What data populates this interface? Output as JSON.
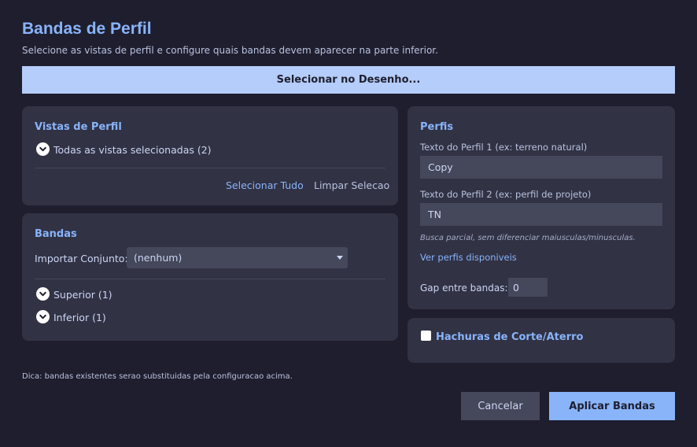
{
  "header": {
    "title": "Bandas de Perfil",
    "subtitle": "Selecione as vistas de perfil e configure quais bandas devem aparecer na parte inferior."
  },
  "select_button_label": "Selecionar no Desenho...",
  "vistas": {
    "title": "Vistas de Perfil",
    "all_selected_label": "Todas as vistas selecionadas (2)",
    "select_all_label": "Selecionar Tudo",
    "clear_label": "Limpar Selecao"
  },
  "bandas": {
    "title": "Bandas",
    "import_label": "Importar Conjunto:",
    "import_value": "(nenhum)",
    "superior_label": "Superior (1)",
    "inferior_label": "Inferior (1)"
  },
  "perfis": {
    "title": "Perfis",
    "profile1_label": "Texto do Perfil 1 (ex: terreno natural)",
    "profile1_value": "Copy",
    "profile2_label": "Texto do Perfil 2 (ex: perfil de projeto)",
    "profile2_value": "TN",
    "hint": "Busca parcial, sem diferenciar maiusculas/minusculas.",
    "view_profiles_link": "Ver perfis disponiveis",
    "gap_label": "Gap entre bandas:",
    "gap_value": "0"
  },
  "hachuras": {
    "label": "Hachuras de Corte/Aterro",
    "checked": false
  },
  "footer": {
    "hint": "Dica: bandas existentes serao substituidas pela configuracao acima.",
    "cancel_label": "Cancelar",
    "apply_label": "Aplicar Bandas"
  },
  "colors": {
    "background": "#1e1e2e",
    "panel": "#313244",
    "accent": "#89b4fa",
    "select_button": "#b4cdfa",
    "input": "#45475a"
  },
  "icons": {
    "chevron": "chevron-down-icon"
  }
}
